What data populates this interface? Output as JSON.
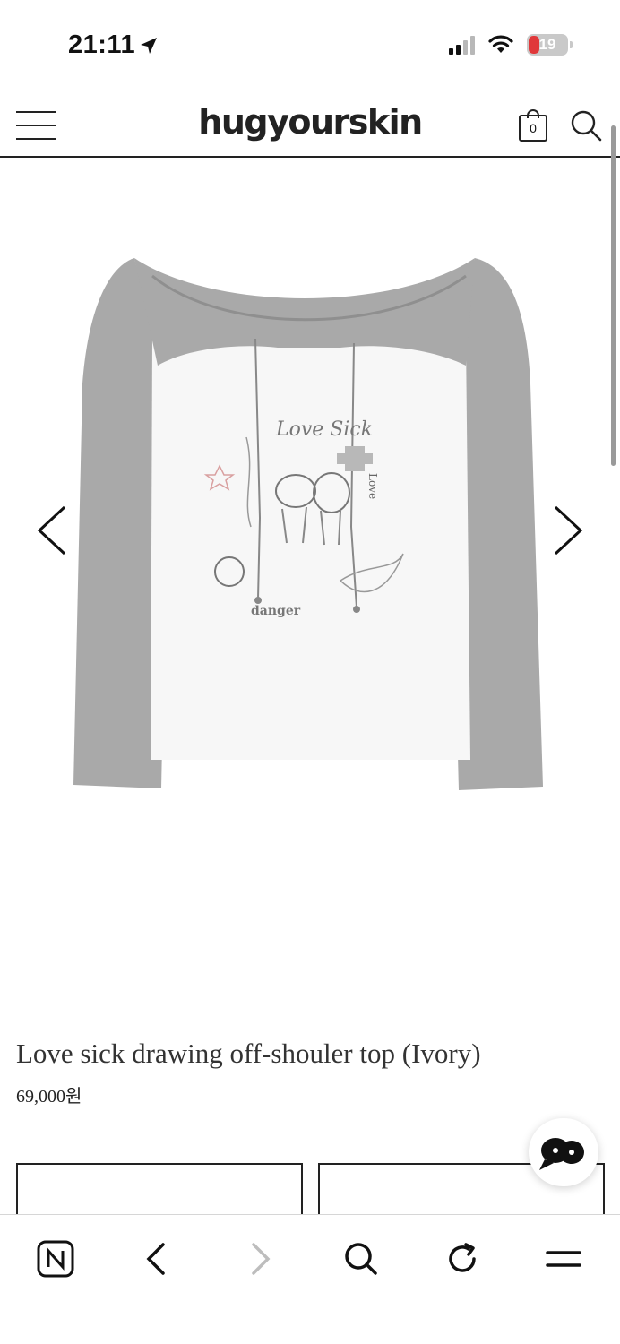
{
  "status_bar": {
    "time": "21:11",
    "battery_percent": "19",
    "icons": [
      "location-arrow-icon",
      "signal-icon",
      "wifi-icon",
      "battery-icon"
    ]
  },
  "header": {
    "logo": "hugyourskin",
    "cart_count": "0",
    "icons": [
      "menu-icon",
      "cart-icon",
      "search-icon"
    ]
  },
  "gallery": {
    "image_description_icon": "product-photo",
    "print_texts": [
      "Love Sick",
      "Love",
      "danger"
    ],
    "icons": [
      "chevron-left-icon",
      "chevron-right-icon"
    ]
  },
  "product": {
    "title": "Love sick drawing off-shouler top (Ivory)",
    "price": "69,000원"
  },
  "chat_fab": {
    "icon": "chat-bubble-icon"
  },
  "browser_toolbar": {
    "icons": [
      "naver-home-icon",
      "back-icon",
      "forward-icon",
      "search-icon",
      "reload-icon",
      "menu-icon"
    ]
  },
  "colors": {
    "sleeve_gray": "#a9a9a9",
    "body_white": "#f7f7f7",
    "battery_red": "#e0383a",
    "text_dark": "#222222"
  }
}
